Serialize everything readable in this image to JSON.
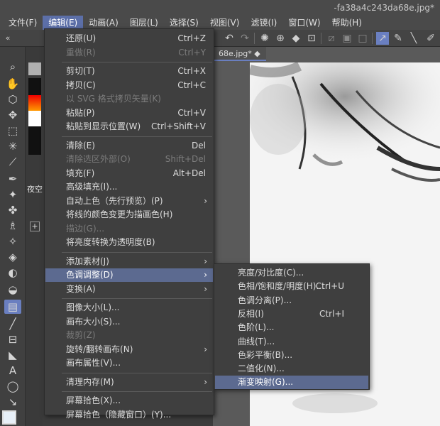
{
  "window": {
    "title": "-fa38a4c243da68e.jpg*"
  },
  "menubar": [
    {
      "label": "文件(F)"
    },
    {
      "label": "编辑(E)",
      "active": true
    },
    {
      "label": "动画(A)"
    },
    {
      "label": "图层(L)"
    },
    {
      "label": "选择(S)"
    },
    {
      "label": "视图(V)"
    },
    {
      "label": "滤镜(I)"
    },
    {
      "label": "窗口(W)"
    },
    {
      "label": "帮助(H)"
    }
  ],
  "document_tab": {
    "label": "68e.jpg* ◆"
  },
  "left_panel_text": {
    "layer_name": "夜空"
  },
  "edit_menu": {
    "items": [
      {
        "label": "还原(U)",
        "shortcut": "Ctrl+Z",
        "disabled": false
      },
      {
        "label": "重做(R)",
        "shortcut": "Ctrl+Y",
        "disabled": true
      },
      {
        "sep": true
      },
      {
        "label": "剪切(T)",
        "shortcut": "Ctrl+X",
        "disabled": false
      },
      {
        "label": "拷贝(C)",
        "shortcut": "Ctrl+C",
        "disabled": false
      },
      {
        "label": "以 SVG 格式拷贝矢量(K)",
        "shortcut": "",
        "disabled": true
      },
      {
        "label": "粘贴(P)",
        "shortcut": "Ctrl+V",
        "disabled": false
      },
      {
        "label": "粘贴到显示位置(W)",
        "shortcut": "Ctrl+Shift+V",
        "disabled": false
      },
      {
        "sep": true
      },
      {
        "label": "清除(E)",
        "shortcut": "Del",
        "disabled": false
      },
      {
        "label": "清除选区外部(O)",
        "shortcut": "Shift+Del",
        "disabled": true
      },
      {
        "label": "填充(F)",
        "shortcut": "Alt+Del",
        "disabled": false
      },
      {
        "label": "高级填充(I)...",
        "shortcut": "",
        "disabled": false
      },
      {
        "label": "自动上色（先行预览）(P)",
        "shortcut": "",
        "disabled": false,
        "submenu": true
      },
      {
        "label": "将线的颜色变更为描画色(H)",
        "shortcut": "",
        "disabled": false
      },
      {
        "label": "描边(G)...",
        "shortcut": "",
        "disabled": true
      },
      {
        "label": "将亮度转换为透明度(B)",
        "shortcut": "",
        "disabled": false
      },
      {
        "sep": true
      },
      {
        "label": "添加素材(J)",
        "shortcut": "",
        "disabled": false,
        "submenu": true
      },
      {
        "label": "色调调整(D)",
        "shortcut": "",
        "disabled": false,
        "submenu": true,
        "highlighted": true
      },
      {
        "label": "变换(A)",
        "shortcut": "",
        "disabled": false,
        "submenu": true
      },
      {
        "sep": true
      },
      {
        "label": "图像大小(L)...",
        "shortcut": "",
        "disabled": false
      },
      {
        "label": "画布大小(S)...",
        "shortcut": "",
        "disabled": false
      },
      {
        "label": "裁剪(Z)",
        "shortcut": "",
        "disabled": true
      },
      {
        "label": "旋转/翻转画布(N)",
        "shortcut": "",
        "disabled": false,
        "submenu": true
      },
      {
        "label": "画布属性(V)...",
        "shortcut": "",
        "disabled": false
      },
      {
        "sep": true
      },
      {
        "label": "清理内存(M)",
        "shortcut": "",
        "disabled": false,
        "submenu": true
      },
      {
        "sep": true
      },
      {
        "label": "屏幕拾色(X)...",
        "shortcut": "",
        "disabled": false
      },
      {
        "label": "屏幕拾色（隐藏窗口）(Y)...",
        "shortcut": "",
        "disabled": false
      }
    ]
  },
  "tone_submenu": {
    "items": [
      {
        "label": "亮度/对比度(C)...",
        "shortcut": ""
      },
      {
        "label": "色相/饱和度/明度(H)...",
        "shortcut": "Ctrl+U"
      },
      {
        "label": "色调分离(P)...",
        "shortcut": ""
      },
      {
        "label": "反相(I)",
        "shortcut": "Ctrl+I"
      },
      {
        "label": "色阶(L)...",
        "shortcut": ""
      },
      {
        "label": "曲线(T)...",
        "shortcut": ""
      },
      {
        "label": "色彩平衡(B)...",
        "shortcut": ""
      },
      {
        "label": "二值化(N)...",
        "shortcut": ""
      },
      {
        "label": "渐变映射(G)...",
        "shortcut": "",
        "highlighted": true
      }
    ]
  },
  "icons": {
    "submenu_arrow": "chevron-right-icon"
  },
  "colors": {
    "accent": "#5c6fa8",
    "highlight": "#5c6a90"
  }
}
